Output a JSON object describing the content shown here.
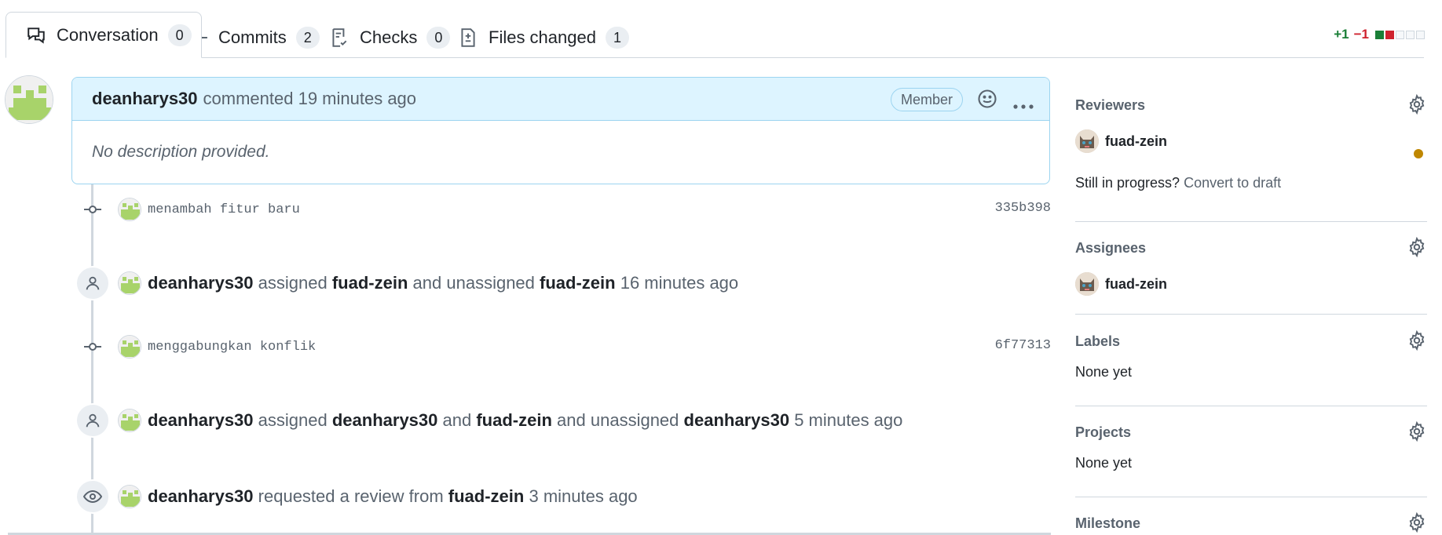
{
  "tabs": [
    {
      "label": "Conversation",
      "count": "0",
      "icon": "comment-discussion-icon"
    },
    {
      "label": "Commits",
      "count": "2",
      "icon": "git-commit-icon"
    },
    {
      "label": "Checks",
      "count": "0",
      "icon": "checklist-icon"
    },
    {
      "label": "Files changed",
      "count": "1",
      "icon": "file-diff-icon"
    }
  ],
  "diffstat": {
    "additions": "+1",
    "deletions": "−1"
  },
  "colors": {
    "accent_blue_bg": "#ddf4ff",
    "add": "#1a7f37",
    "del": "#cf222e",
    "pending": "#bf8700"
  },
  "comment": {
    "author": "deanharys30",
    "meta": "commented 19 minutes ago",
    "badge": "Member",
    "body": "No description provided."
  },
  "timeline": {
    "commit1": {
      "message": "menambah fitur baru",
      "sha": "335b398"
    },
    "event1": {
      "actor": "deanharys30",
      "t1": "assigned",
      "u1": "fuad-zein",
      "t2": "and unassigned",
      "u2": "fuad-zein",
      "time": "16 minutes ago"
    },
    "commit2": {
      "message": "menggabungkan konflik",
      "sha": "6f77313"
    },
    "event2": {
      "actor": "deanharys30",
      "t1": "assigned",
      "u1": "deanharys30",
      "t2": "and",
      "u2": "fuad-zein",
      "t3": "and unassigned",
      "u3": "deanharys30",
      "time": "5 minutes ago"
    },
    "event3": {
      "actor": "deanharys30",
      "t1": "requested a review from",
      "u1": "fuad-zein",
      "time": "3 minutes ago"
    }
  },
  "sidebar": {
    "reviewers": {
      "title": "Reviewers",
      "user": "fuad-zein",
      "draft_prompt": "Still in progress?",
      "draft_link": "Convert to draft"
    },
    "assignees": {
      "title": "Assignees",
      "user": "fuad-zein"
    },
    "labels": {
      "title": "Labels",
      "value": "None yet"
    },
    "projects": {
      "title": "Projects",
      "value": "None yet"
    },
    "milestone": {
      "title": "Milestone"
    }
  }
}
